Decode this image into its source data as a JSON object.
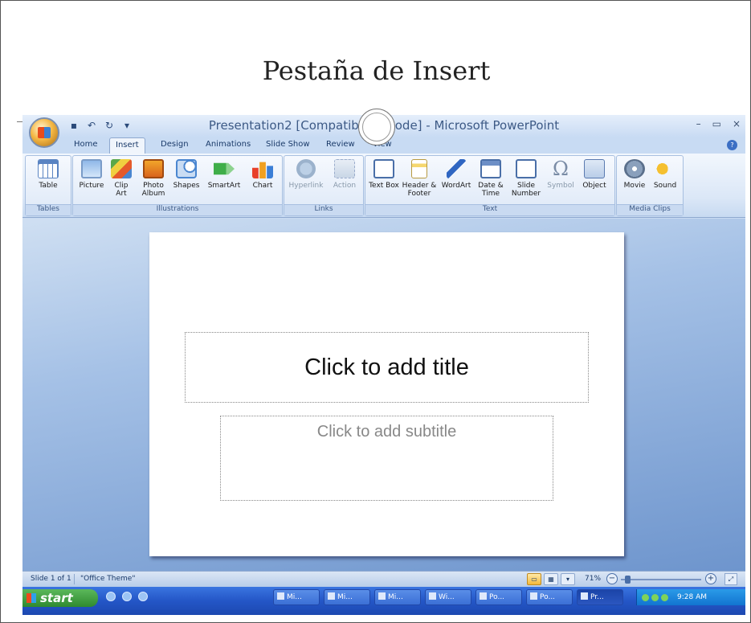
{
  "heading": "Pestaña de Insert",
  "window": {
    "title": "Presentation2 [Compatibility Mode] - Microsoft PowerPoint",
    "controls": {
      "minimize": "–",
      "maximize": "▭",
      "close": "×"
    }
  },
  "qat": {
    "save": "▪",
    "undo": "↶",
    "redo": "↻",
    "more": "▾"
  },
  "tabs": [
    "Home",
    "Insert",
    "Design",
    "Animations",
    "Slide Show",
    "Review",
    "View"
  ],
  "active_tab": "Insert",
  "ribbon": {
    "groups": {
      "tables": "Tables",
      "illustrations": "Illustrations",
      "links": "Links",
      "text": "Text",
      "media": "Media Clips"
    },
    "buttons": {
      "table": "Table",
      "picture": "Picture",
      "clip_art": "Clip Art",
      "photo_album": "Photo Album",
      "shapes": "Shapes",
      "smartart": "SmartArt",
      "chart": "Chart",
      "hyperlink": "Hyperlink",
      "action": "Action",
      "text_box": "Text Box",
      "header_footer": "Header & Footer",
      "wordart": "WordArt",
      "date_time": "Date & Time",
      "slide_number": "Slide Number",
      "symbol": "Symbol",
      "object": "Object",
      "movie": "Movie",
      "sound": "Sound",
      "symbol_glyph": "Ω"
    }
  },
  "slide": {
    "title_placeholder": "Click to add title",
    "subtitle_placeholder": "Click to add subtitle"
  },
  "status": {
    "slide": "Slide 1 of 1",
    "theme": "\"Office Theme\"",
    "zoom": "71%",
    "zoom_level": 0.05
  },
  "taskbar": {
    "start": "start",
    "tasks": [
      "Mi...",
      "Mi...",
      "Mi...",
      "Wi...",
      "Po...",
      "Po...",
      "Pr..."
    ],
    "clock": "9:28 AM"
  }
}
